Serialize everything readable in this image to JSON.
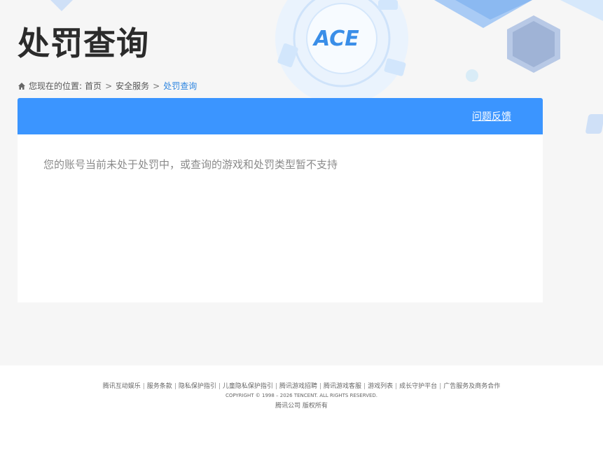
{
  "header": {
    "title": "处罚查询",
    "logo_text": "ACE"
  },
  "breadcrumb": {
    "prefix": "您现在的位置:",
    "items": [
      "首页",
      "安全服务",
      "处罚查询"
    ],
    "separator": ">"
  },
  "card": {
    "feedback_label": "问题反馈",
    "notice": "您的账号当前未处于处罚中，或查询的游戏和处罚类型暂不支持"
  },
  "footer": {
    "links": [
      "腾讯互动娱乐",
      "服务条款",
      "隐私保护指引",
      "儿童隐私保护指引",
      "腾讯游戏招聘",
      "腾讯游戏客服",
      "游戏列表",
      "成长守护平台",
      "广告服务及商务合作"
    ],
    "copyright": "COPYRIGHT © 1998 – 2026 TENCENT. ALL RIGHTS RESERVED.",
    "company": "腾讯公司 版权所有"
  },
  "colors": {
    "accent": "#3b95ff",
    "breadcrumb_current": "#2f86e0",
    "title": "#2b2b2b"
  },
  "icons": [
    "home-icon",
    "ace-logo"
  ]
}
